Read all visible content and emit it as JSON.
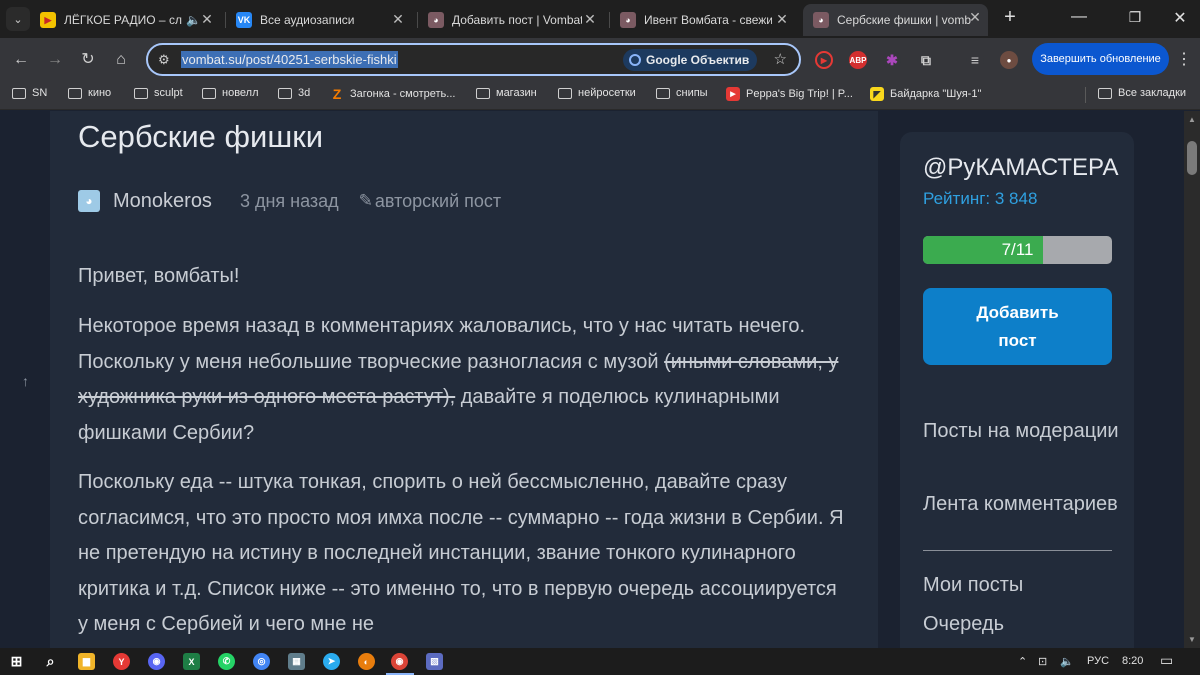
{
  "browser": {
    "tabs": [
      {
        "title": "ЛЁГКОЕ РАДИО – сл",
        "favicon_color": "#f2c200",
        "favicon_glyph": "▶",
        "audio": true,
        "active": false
      },
      {
        "title": "Все аудиозаписи",
        "favicon_color": "#2787f5",
        "favicon_glyph": "VK",
        "active": false
      },
      {
        "title": "Добавить пост | Vombat",
        "favicon_color": "#7b5a62",
        "favicon_glyph": "🐨",
        "active": false
      },
      {
        "title": "Ивент Вомбата - свежие",
        "favicon_color": "#7b5a62",
        "favicon_glyph": "🐨",
        "active": false
      },
      {
        "title": "Сербские фишки | vomb",
        "favicon_color": "#7b5a62",
        "favicon_glyph": "🐨",
        "active": true
      }
    ],
    "new_tab_icon": "plus-icon",
    "address_url": "vombat.su/post/40251-serbskie-fishki",
    "lens_label": "Google Объектив",
    "update_button": "Завершить обновление",
    "extensions": [
      {
        "name": "youtube-ext-icon",
        "color": "#e53935",
        "glyph": "▶"
      },
      {
        "name": "adblock-icon",
        "color": "#d32f2f",
        "glyph": "ABP"
      },
      {
        "name": "color-ext-icon",
        "color": "#7b1fa2",
        "glyph": "✱"
      },
      {
        "name": "puzzle-icon",
        "color": "#35363a",
        "glyph": "⧉"
      },
      {
        "name": "media-icon",
        "color": "#35363a",
        "glyph": "≡"
      },
      {
        "name": "profile-avatar",
        "color": "#6d4c41",
        "glyph": "●"
      }
    ],
    "bookmarks": [
      {
        "label": "SN",
        "type": "folder"
      },
      {
        "label": "кино",
        "type": "folder"
      },
      {
        "label": "sculpt",
        "type": "folder"
      },
      {
        "label": "новелл",
        "type": "folder"
      },
      {
        "label": "3d",
        "type": "folder"
      },
      {
        "label": "Загонка - смотреть...",
        "type": "site",
        "color": "#f57c00",
        "glyph": "Z"
      },
      {
        "label": "магазин",
        "type": "folder"
      },
      {
        "label": "нейросетки",
        "type": "folder"
      },
      {
        "label": "снипы",
        "type": "folder"
      },
      {
        "label": "Peppa's Big Trip! | P...",
        "type": "site",
        "color": "#e53935",
        "glyph": "▶"
      },
      {
        "label": "Байдарка \"Шуя-1\"",
        "type": "site",
        "color": "#f9d71c",
        "glyph": "◤"
      }
    ],
    "all_bookmarks": "Все закладки"
  },
  "post": {
    "title": "Сербские фишки",
    "author": "Monokeros",
    "date": "3 дня назад",
    "kind": "авторский пост",
    "greeting": "Привет, вомбаты!",
    "p1_before": "Некоторое время назад в комментариях жаловались, что у нас читать нечего. Поскольку у меня небольшие творческие разногласия с музой ",
    "p1_strike": "(иными словами, у художника руки из одного места растут),",
    "p1_after": " давайте я поделюсь кулинарными фишками Сербии?",
    "p2": "Поскольку еда -- штука тонкая, спорить о ней бессмысленно, давайте сразу согласимся, что это просто моя имха после -- суммарно -- года жизни в Сербии. Я не претендую на истину в последней инстанции, звание тонкого кулинарного критика и т.д. Список ниже -- это именно то, что в первую очередь ассоциируется у меня с Сербией и чего мне не"
  },
  "sidebar": {
    "username": "@РуКАМАСТЕРА",
    "rating": "Рейтинг: 3 848",
    "progress_text": "7/11",
    "progress_fraction": 0.6364,
    "add_post": "Добавить пост",
    "links": [
      "Посты на модерации",
      "Лента комментариев",
      "Мои посты",
      "Очередь"
    ]
  },
  "taskbar": {
    "apps": [
      {
        "name": "explorer-icon",
        "color": "#f0b429",
        "glyph": "▆"
      },
      {
        "name": "yandex-browser-icon",
        "color": "#e53935",
        "glyph": "Y"
      },
      {
        "name": "discord-icon",
        "color": "#5865f2",
        "glyph": "◉"
      },
      {
        "name": "excel-icon",
        "color": "#1e7e45",
        "glyph": "X"
      },
      {
        "name": "whatsapp-icon",
        "color": "#25d366",
        "glyph": "✆"
      },
      {
        "name": "chromium-icon",
        "color": "#4285f4",
        "glyph": "◎"
      },
      {
        "name": "calculator-icon",
        "color": "#607d8b",
        "glyph": "▦"
      },
      {
        "name": "telegram-icon",
        "color": "#2aabee",
        "glyph": "➤"
      },
      {
        "name": "blender-icon",
        "color": "#e87d0d",
        "glyph": "◐"
      },
      {
        "name": "chrome-icon",
        "color": "#db4437",
        "glyph": "◉"
      },
      {
        "name": "photos-icon",
        "color": "#5c6bc0",
        "glyph": "▧"
      }
    ],
    "language": "РУС",
    "time": "8:20"
  },
  "colors": {
    "page_bg": "#1b2230",
    "card_bg": "#222b3a",
    "accent": "#0d7fc9",
    "rating": "#2fa0e0",
    "progress": "#3bab4f"
  }
}
